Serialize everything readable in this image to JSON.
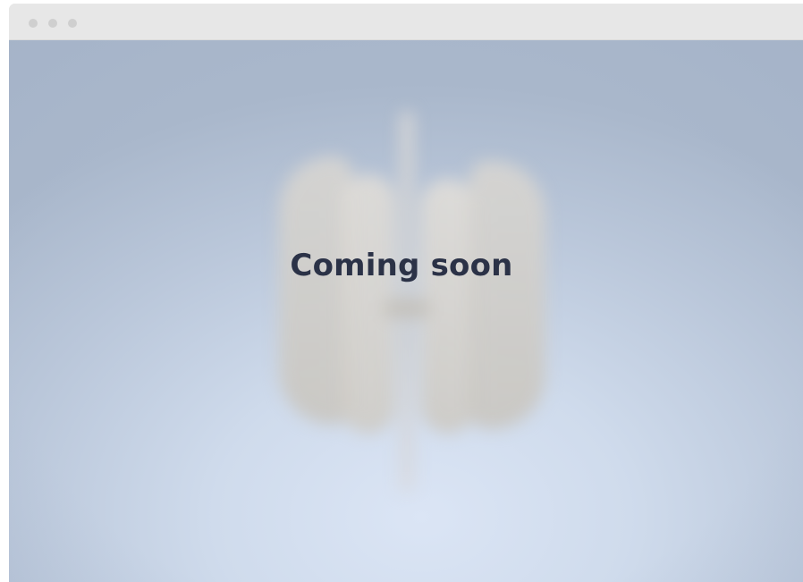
{
  "window": {
    "controls": [
      "close",
      "minimize",
      "maximize"
    ]
  },
  "main": {
    "heading": "Coming soon",
    "background_colors": {
      "center": "#dbe5f5",
      "edge": "#a9b7cb",
      "heading": "#2b3247"
    },
    "preview_image": "blurred-vertical-wind-turbine-model"
  }
}
